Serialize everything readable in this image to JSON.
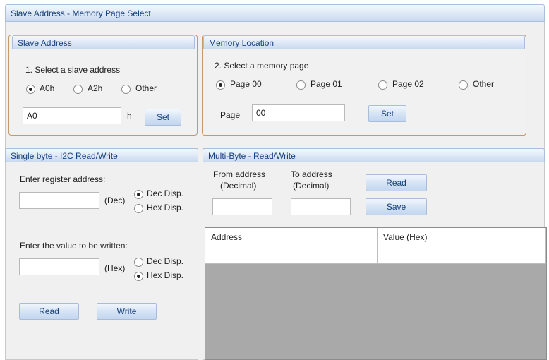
{
  "window": {
    "title": "Slave Address - Memory Page Select"
  },
  "slave_address": {
    "title": "Slave Address",
    "prompt": "1. Select a slave address",
    "options": [
      "A0h",
      "A2h",
      "Other"
    ],
    "selected": "A0h",
    "value": "A0",
    "unit": "h",
    "set_label": "Set"
  },
  "memory_location": {
    "title": "Memory Location",
    "prompt": "2. Select a memory page",
    "options": [
      "Page 00",
      "Page 01",
      "Page 02",
      "Other"
    ],
    "selected": "Page 00",
    "page_label": "Page",
    "page_value": "00",
    "set_label": "Set"
  },
  "single_byte": {
    "title": "Single byte - I2C Read/Write",
    "register_prompt": "Enter register address:",
    "register_value": "",
    "register_unit": "(Dec)",
    "register_disp_options": [
      "Dec Disp.",
      "Hex Disp."
    ],
    "register_disp_selected": "Dec Disp.",
    "value_prompt": "Enter the value to be written:",
    "value_value": "",
    "value_unit": "(Hex)",
    "value_disp_options": [
      "Dec Disp.",
      "Hex Disp."
    ],
    "value_disp_selected": "Hex Disp.",
    "read_label": "Read",
    "write_label": "Write"
  },
  "multi_byte": {
    "title": "Multi-Byte - Read/Write",
    "from_label_1": "From address",
    "from_label_2": "(Decimal)",
    "to_label_1": "To address",
    "to_label_2": "(Decimal)",
    "from_value": "",
    "to_value": "",
    "read_label": "Read",
    "save_label": "Save",
    "columns": [
      "Address",
      "Value (Hex)"
    ]
  }
}
